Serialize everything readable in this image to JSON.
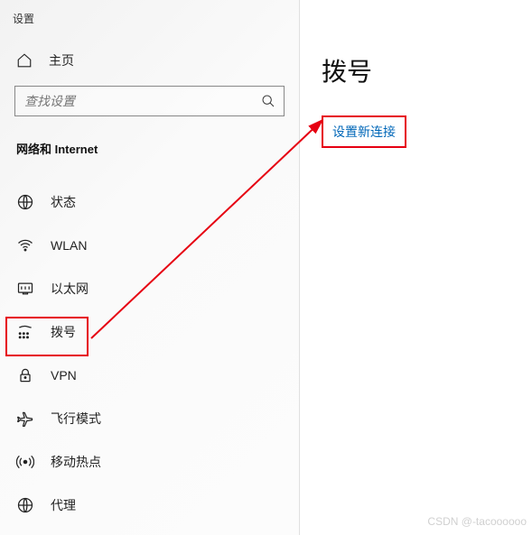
{
  "window": {
    "title": "设置"
  },
  "sidebar": {
    "home_label": "主页",
    "search_placeholder": "查找设置",
    "section_header": "网络和 Internet",
    "items": [
      {
        "label": "状态",
        "icon": "status-icon"
      },
      {
        "label": "WLAN",
        "icon": "wifi-icon"
      },
      {
        "label": "以太网",
        "icon": "ethernet-icon"
      },
      {
        "label": "拨号",
        "icon": "dialup-icon"
      },
      {
        "label": "VPN",
        "icon": "vpn-icon"
      },
      {
        "label": "飞行模式",
        "icon": "airplane-icon"
      },
      {
        "label": "移动热点",
        "icon": "hotspot-icon"
      },
      {
        "label": "代理",
        "icon": "proxy-icon"
      }
    ]
  },
  "main": {
    "title": "拨号",
    "new_connection_label": "设置新连接"
  },
  "watermark": "CSDN @-tacoooooo",
  "colors": {
    "link": "#0067b8",
    "highlight": "#e60012"
  }
}
